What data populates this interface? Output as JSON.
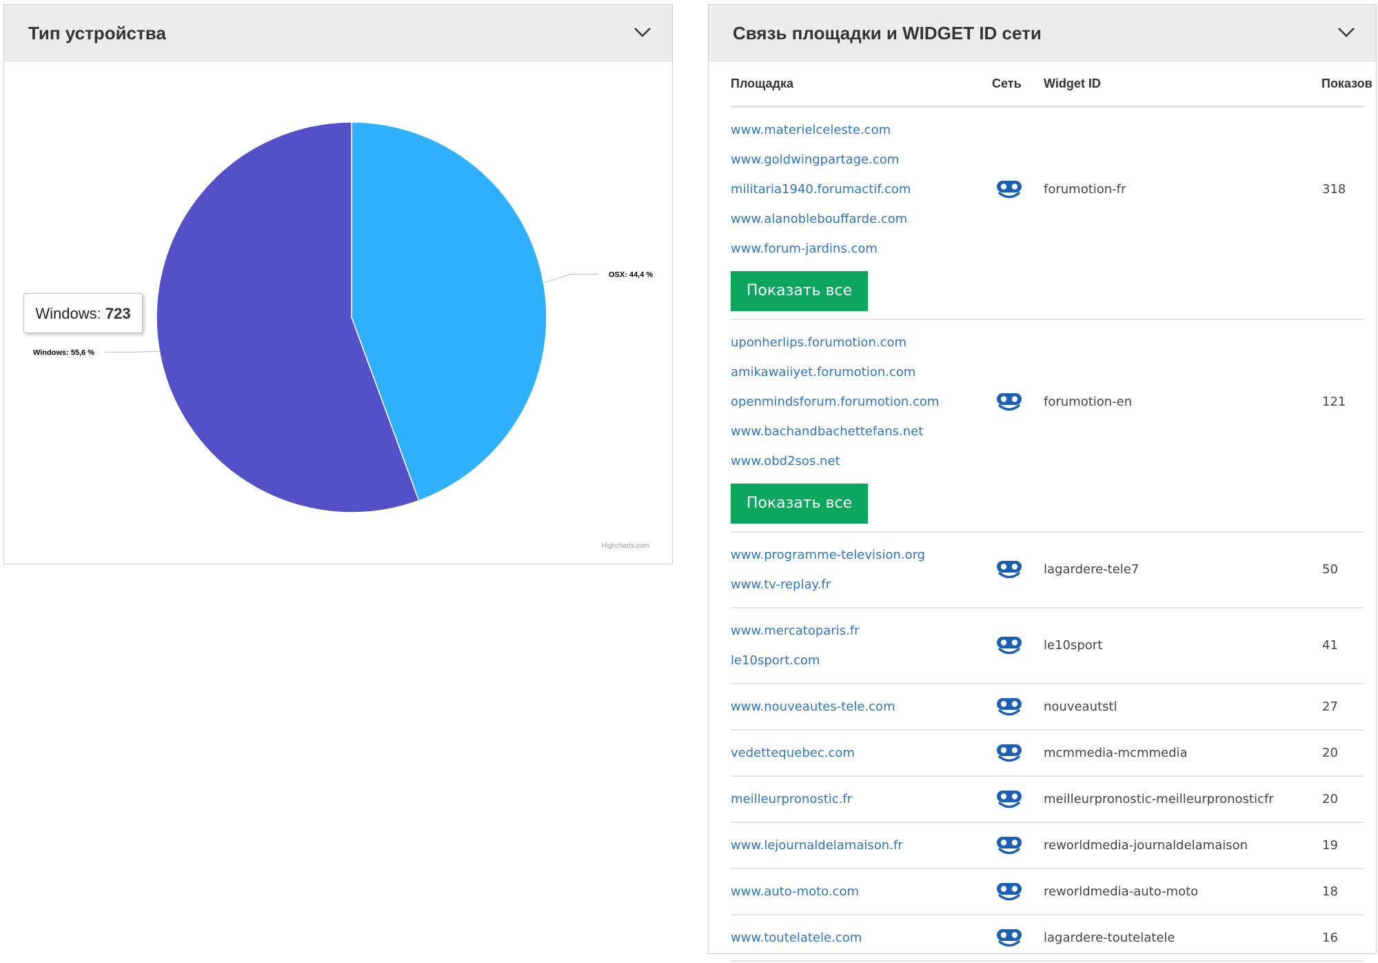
{
  "device_panel": {
    "title": "Тип устройства",
    "tooltip": {
      "name": "Windows",
      "value": "723"
    },
    "credits": "Highcharts.com"
  },
  "chart_data": {
    "type": "pie",
    "slices": [
      {
        "name": "OSX",
        "value": 44.4,
        "label": "OSX: 44,4 %",
        "color": "#2eb0fd"
      },
      {
        "name": "Windows",
        "value": 55.6,
        "label": "Windows: 55,6 %",
        "color": "#5451c8"
      }
    ]
  },
  "network_panel": {
    "title": "Связь площадки и WIDGET ID сети",
    "columns": {
      "site": "Площадка",
      "network": "Сеть",
      "widget": "Widget ID",
      "views": "Показов"
    },
    "show_all_label": "Показать все",
    "network_icon": "forumotion-network-icon",
    "link_color": "#2f76b8",
    "button_color": "#0da65f",
    "rows": [
      {
        "sites": [
          "www.materielceleste.com",
          "www.goldwingpartage.com",
          "militaria1940.forumactif.com",
          "www.alanoblebouffarde.com",
          "www.forum-jardins.com"
        ],
        "widget": "forumotion-fr",
        "views": "318",
        "show_all": true
      },
      {
        "sites": [
          "uponherlips.forumotion.com",
          "amikawaiiyet.forumotion.com",
          "openmindsforum.forumotion.com",
          "www.bachandbachettefans.net",
          "www.obd2sos.net"
        ],
        "widget": "forumotion-en",
        "views": "121",
        "show_all": true
      },
      {
        "sites": [
          "www.programme-television.org",
          "www.tv-replay.fr"
        ],
        "widget": "lagardere-tele7",
        "views": "50"
      },
      {
        "sites": [
          "www.mercatoparis.fr",
          "le10sport.com"
        ],
        "widget": "le10sport",
        "views": "41"
      },
      {
        "sites": [
          "www.nouveautes-tele.com"
        ],
        "widget": "nouveautstl",
        "views": "27"
      },
      {
        "sites": [
          "vedettequebec.com"
        ],
        "widget": "mcmmedia-mcmmedia",
        "views": "20"
      },
      {
        "sites": [
          "meilleurpronostic.fr"
        ],
        "widget": "meilleurpronostic-meilleurpronosticfr",
        "views": "20"
      },
      {
        "sites": [
          "www.lejournaldelamaison.fr"
        ],
        "widget": "reworldmedia-journaldelamaison",
        "views": "19"
      },
      {
        "sites": [
          "www.auto-moto.com"
        ],
        "widget": "reworldmedia-auto-moto",
        "views": "18"
      },
      {
        "sites": [
          "www.toutelatele.com"
        ],
        "widget": "lagardere-toutelatele",
        "views": "16"
      }
    ]
  }
}
